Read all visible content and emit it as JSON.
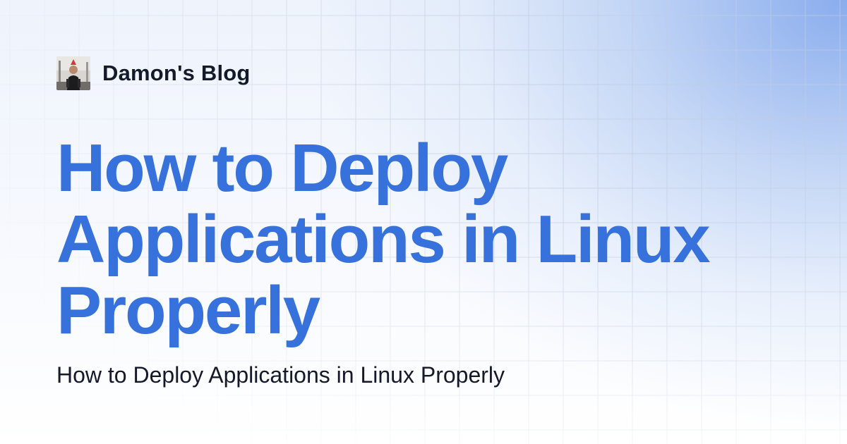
{
  "site": {
    "name": "Damon's Blog",
    "avatar_icon": "author-avatar-photo"
  },
  "post": {
    "title": "How to Deploy Applications in Linux Properly",
    "description": "How to Deploy Applications in Linux Properly"
  },
  "colors": {
    "title": "#3671dc",
    "text": "#15192a",
    "accent_gradient": "#7aa2eb",
    "grid_line": "#c9d3e4"
  }
}
